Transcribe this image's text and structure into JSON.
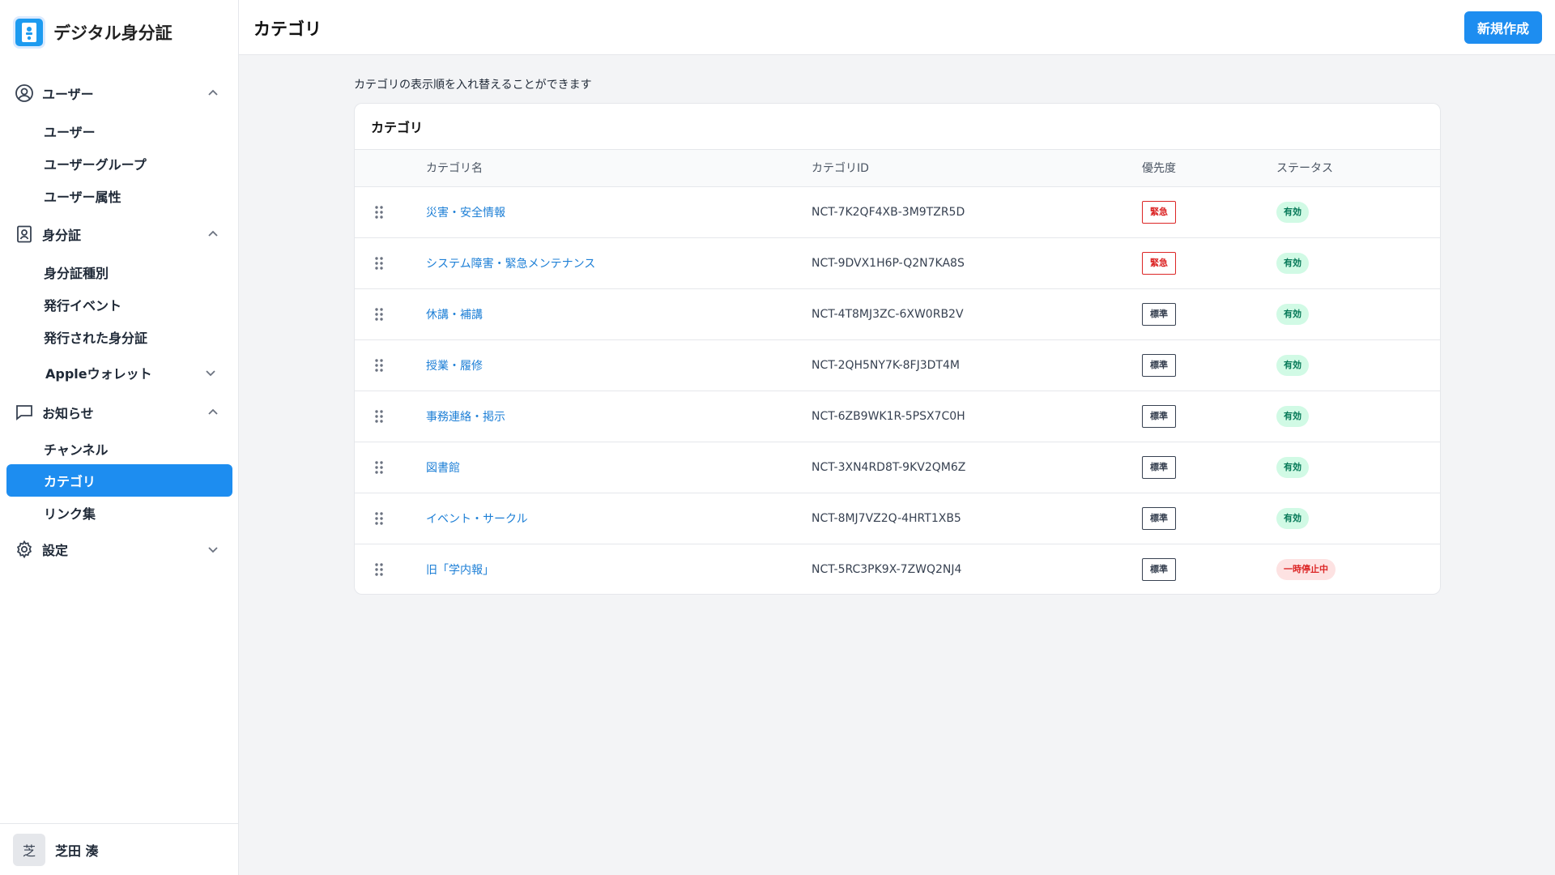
{
  "app": {
    "title": "デジタル身分証"
  },
  "sidebar": {
    "groups": [
      {
        "label": "ユーザー",
        "items": [
          "ユーザー",
          "ユーザーグループ",
          "ユーザー属性"
        ]
      },
      {
        "label": "身分証",
        "items": [
          "身分証種別",
          "発行イベント",
          "発行された身分証"
        ],
        "subgroup": "Appleウォレット"
      },
      {
        "label": "お知らせ",
        "items": [
          "チャンネル",
          "カテゴリ",
          "リンク集"
        ]
      },
      {
        "label": "設定"
      }
    ]
  },
  "user": {
    "avatar": "芝",
    "name": "芝田 湊"
  },
  "header": {
    "title": "カテゴリ",
    "new_button": "新規作成"
  },
  "main": {
    "description": "カテゴリの表示順を入れ替えることができます",
    "card_title": "カテゴリ",
    "columns": [
      "カテゴリ名",
      "カテゴリID",
      "優先度",
      "ステータス"
    ],
    "rows": [
      {
        "name": "災害・安全情報",
        "id": "NCT-7K2QF4XB-3M9TZR5D",
        "priority": "緊急",
        "status": "有効"
      },
      {
        "name": "システム障害・緊急メンテナンス",
        "id": "NCT-9DVX1H6P-Q2N7KA8S",
        "priority": "緊急",
        "status": "有効"
      },
      {
        "name": "休講・補講",
        "id": "NCT-4T8MJ3ZC-6XW0RB2V",
        "priority": "標準",
        "status": "有効"
      },
      {
        "name": "授業・履修",
        "id": "NCT-2QH5NY7K-8FJ3DT4M",
        "priority": "標準",
        "status": "有効"
      },
      {
        "name": "事務連絡・掲示",
        "id": "NCT-6ZB9WK1R-5PSX7C0H",
        "priority": "標準",
        "status": "有効"
      },
      {
        "name": "図書館",
        "id": "NCT-3XN4RD8T-9KV2QM6Z",
        "priority": "標準",
        "status": "有効"
      },
      {
        "name": "イベント・サークル",
        "id": "NCT-8MJ7VZ2Q-4HRT1XB5",
        "priority": "標準",
        "status": "有効"
      },
      {
        "name": "旧「学内報」",
        "id": "NCT-5RC3PK9X-7ZWQ2NJ4",
        "priority": "標準",
        "status": "一時停止中"
      }
    ]
  },
  "colors": {
    "accent": "#1d8df0",
    "link": "#1d7fd6",
    "urgent": "#dc2626",
    "active_green": "#047857"
  }
}
